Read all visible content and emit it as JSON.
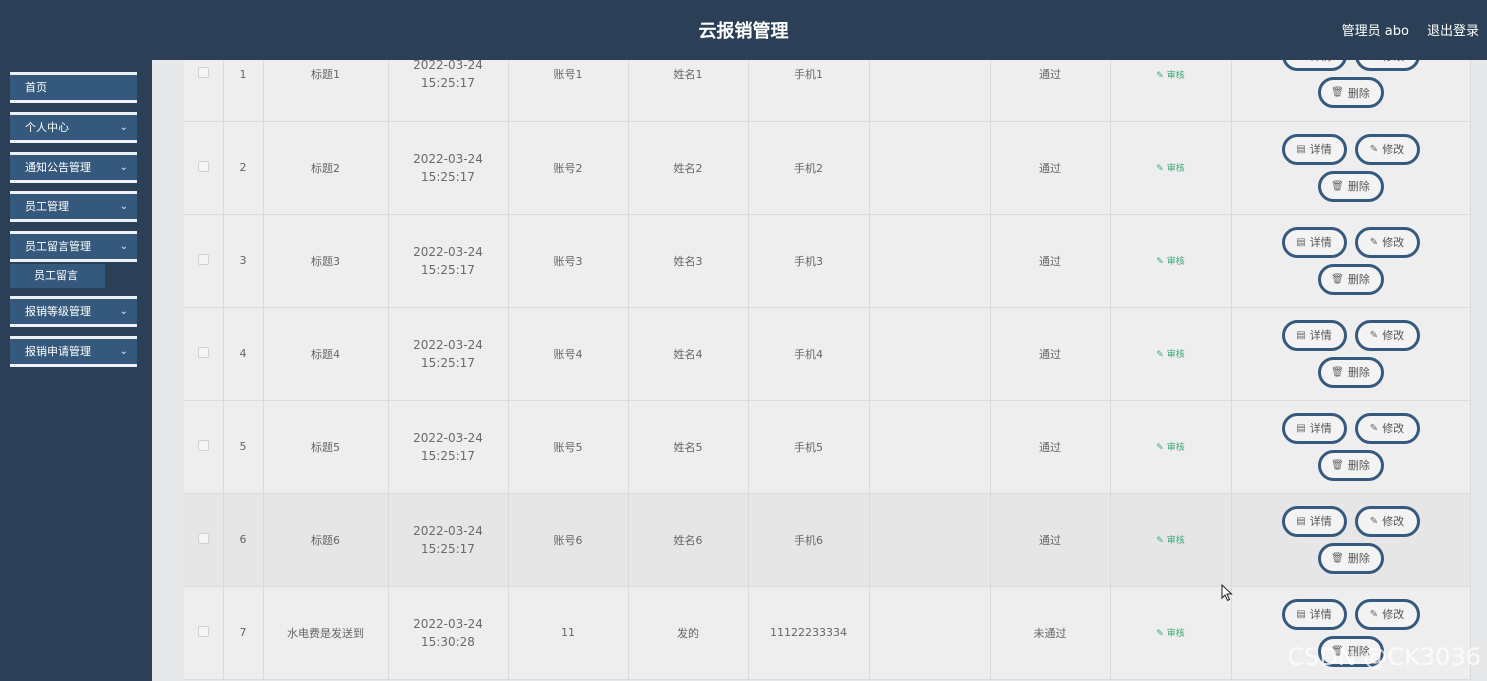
{
  "header": {
    "title": "云报销管理",
    "user_label": "管理员 abo",
    "logout_label": "退出登录"
  },
  "sidebar": {
    "items": [
      {
        "label": "首页"
      },
      {
        "label": "个人中心"
      },
      {
        "label": "通知公告管理"
      },
      {
        "label": "员工管理"
      },
      {
        "label": "员工留言管理"
      },
      {
        "label": "报销等级管理"
      },
      {
        "label": "报销申请管理"
      }
    ],
    "sub_item": {
      "label": "员工留言"
    },
    "chevron_icon": "chevron-down-icon"
  },
  "actions": {
    "audit_label": "审核",
    "detail_label": "详情",
    "edit_label": "修改",
    "delete_label": "删除"
  },
  "rows": [
    {
      "index": "1",
      "title": "标题1",
      "date": "2022-03-24 15:25:17",
      "account": "账号1",
      "name": "姓名1",
      "phone": "手机1",
      "status": "通过"
    },
    {
      "index": "2",
      "title": "标题2",
      "date": "2022-03-24 15:25:17",
      "account": "账号2",
      "name": "姓名2",
      "phone": "手机2",
      "status": "通过"
    },
    {
      "index": "3",
      "title": "标题3",
      "date": "2022-03-24 15:25:17",
      "account": "账号3",
      "name": "姓名3",
      "phone": "手机3",
      "status": "通过"
    },
    {
      "index": "4",
      "title": "标题4",
      "date": "2022-03-24 15:25:17",
      "account": "账号4",
      "name": "姓名4",
      "phone": "手机4",
      "status": "通过"
    },
    {
      "index": "5",
      "title": "标题5",
      "date": "2022-03-24 15:25:17",
      "account": "账号5",
      "name": "姓名5",
      "phone": "手机5",
      "status": "通过"
    },
    {
      "index": "6",
      "title": "标题6",
      "date": "2022-03-24 15:25:17",
      "account": "账号6",
      "name": "姓名6",
      "phone": "手机6",
      "status": "通过"
    },
    {
      "index": "7",
      "title": "水电费是发送到",
      "date": "2022-03-24 15:30:28",
      "account": "11",
      "name": "发的",
      "phone": "11122233334",
      "status": "未通过"
    }
  ],
  "watermark": "CSDN @CK3036",
  "colors": {
    "header_bg": "#2b4057",
    "menu_bg": "#35597d",
    "button_border": "#36597e",
    "audit_green": "#3cab7a"
  }
}
